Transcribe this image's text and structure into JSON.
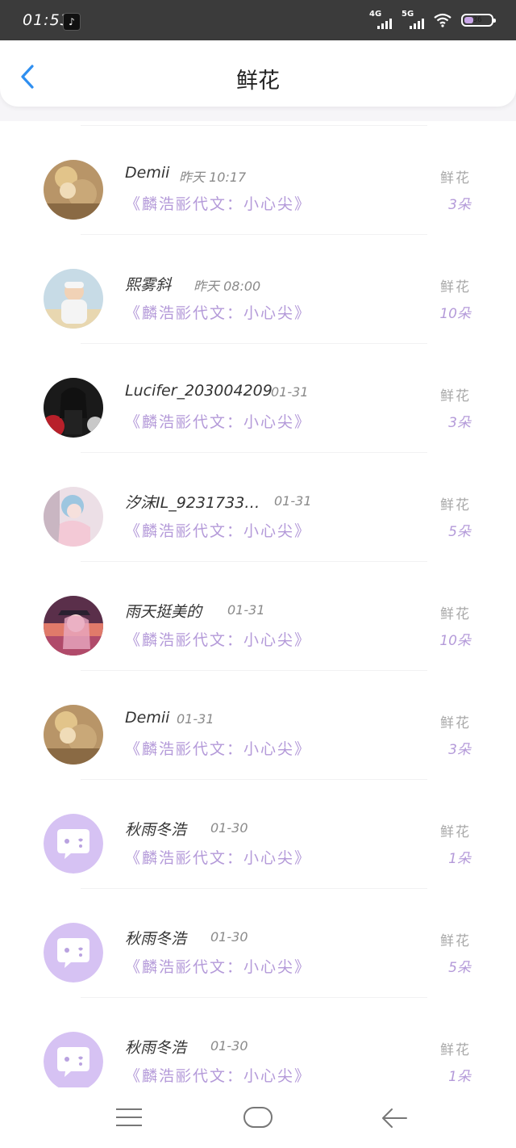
{
  "status_bar": {
    "time": "01:53",
    "app_icon": "tiktok-icon",
    "net1": "4G",
    "net2": "5G",
    "battery": "36"
  },
  "header": {
    "title": "鲜花",
    "back_icon": "chevron-left-icon"
  },
  "rows": [
    {
      "name": "Demii",
      "time": "昨天 10:17",
      "book": "《麟浩彨代文：小心尖》",
      "gift_label": "鲜花",
      "count": "3朵"
    },
    {
      "name": "熙雾斜",
      "time": "昨天 08:00",
      "book": "《麟浩彨代文：小心尖》",
      "gift_label": "鲜花",
      "count": "10朵"
    },
    {
      "name": "Lucifer_203004209",
      "time": "01-31",
      "book": "《麟浩彨代文：小心尖》",
      "gift_label": "鲜花",
      "count": "3朵"
    },
    {
      "name": "汐沫IL_9231733…",
      "time": "01-31",
      "book": "《麟浩彨代文：小心尖》",
      "gift_label": "鲜花",
      "count": "5朵"
    },
    {
      "name": "雨天挺美的",
      "time": "01-31",
      "book": "《麟浩彨代文：小心尖》",
      "gift_label": "鲜花",
      "count": "10朵"
    },
    {
      "name": "Demii",
      "time": "01-31",
      "book": "《麟浩彨代文：小心尖》",
      "gift_label": "鲜花",
      "count": "3朵"
    },
    {
      "name": "秋雨冬浩",
      "time": "01-30",
      "book": "《麟浩彨代文：小心尖》",
      "gift_label": "鲜花",
      "count": "1朵"
    },
    {
      "name": "秋雨冬浩",
      "time": "01-30",
      "book": "《麟浩彨代文：小心尖》",
      "gift_label": "鲜花",
      "count": "5朵"
    },
    {
      "name": "秋雨冬浩",
      "time": "01-30",
      "book": "《麟浩彨代文：小心尖》",
      "gift_label": "鲜花",
      "count": "1朵"
    }
  ],
  "colors": {
    "accent_purple": "#b49ad9",
    "back_blue": "#2f8ff0",
    "default_avatar": "#d6c2f3"
  },
  "nav_bar": {
    "menu_icon": "menu-icon",
    "home_icon": "home-icon",
    "back_icon": "back-arrow-icon"
  }
}
